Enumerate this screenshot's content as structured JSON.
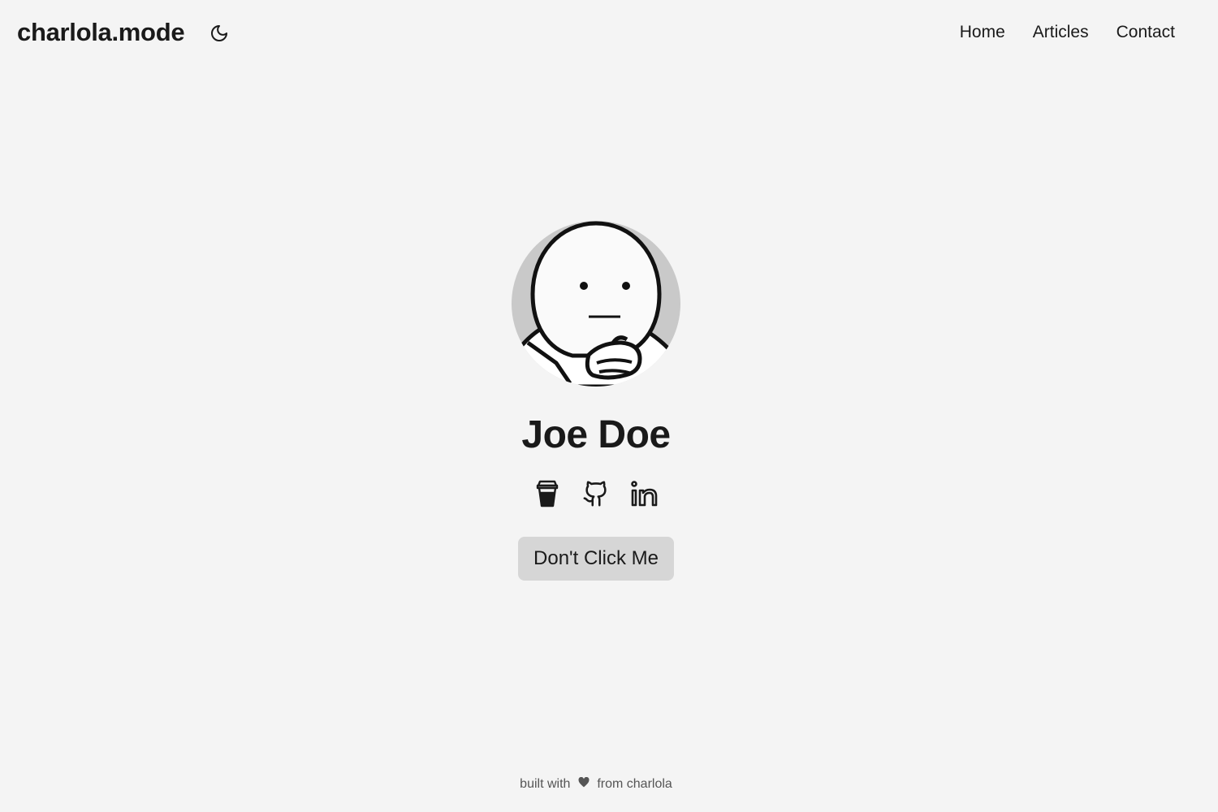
{
  "header": {
    "brand": "charlola.mode",
    "theme_icon": "moon-icon",
    "nav": [
      {
        "label": "Home"
      },
      {
        "label": "Articles"
      },
      {
        "label": "Contact"
      }
    ]
  },
  "profile": {
    "name": "Joe Doe",
    "socials": [
      {
        "icon": "coffee-cup-icon"
      },
      {
        "icon": "github-icon"
      },
      {
        "icon": "linkedin-icon"
      }
    ],
    "button_label": "Don't Click Me"
  },
  "footer": {
    "prefix": "built with",
    "heart_icon": "heart-icon",
    "suffix": "from charlola"
  },
  "colors": {
    "background": "#f4f4f4",
    "text": "#1a1a1a",
    "button_bg": "#d6d6d6",
    "avatar_bg": "#c9c9c9"
  }
}
